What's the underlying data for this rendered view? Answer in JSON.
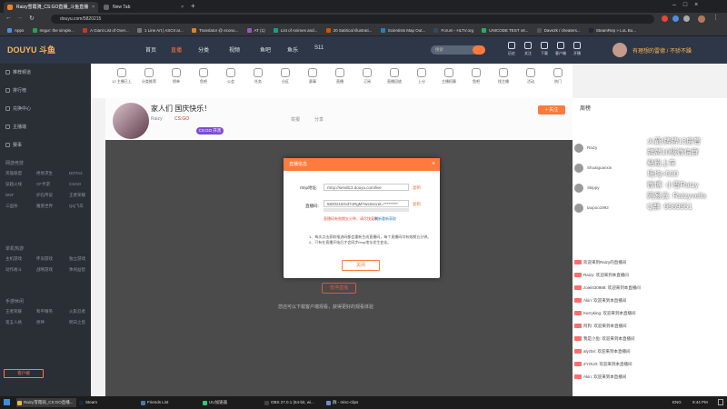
{
  "browser": {
    "tabs": [
      {
        "label": "Raizy雪霞骑_CS:GO直播_斗鱼直播",
        "active": true,
        "color": "#f48024"
      },
      {
        "label": "New Tab",
        "active": false,
        "color": "#666666"
      }
    ],
    "url": "douyu.com/5820215",
    "bookmarks": [
      "Apps",
      "Imgur: the simple...",
      "A Giant List of Over...",
      "1 Line Art | ASCII ar...",
      "Translator @ econo...",
      "AT (1)",
      "List of Animes and...",
      "20 Satirical Illustrati...",
      "Scientists Map Out...",
      "Forum - HLTV.org",
      "UNICODE TEST v8...",
      "Dave2k / cheaters...",
      "SteamRep » LoL Bo..."
    ]
  },
  "header": {
    "logo": "DOUYU 斗鱼",
    "nav": [
      "首页",
      "直播",
      "分类",
      "视频",
      "鱼吧",
      "鱼乐",
      "S11"
    ],
    "search_placeholder": "搜索",
    "icons": [
      "历史",
      "关注",
      "下载",
      "客户端",
      "开播"
    ],
    "user_label": "有理想的雷德 / 不骄不躁"
  },
  "sidebar": {
    "items": [
      "推荐频道",
      "排行榜",
      "兑换中心",
      "主播端",
      "赛事",
      "手机游戏"
    ],
    "sections": [
      {
        "title": "网游竞技",
        "subs": [
          "英雄联盟",
          "绝地求生",
          "DOTA2",
          "穿越火线",
          "CF手游",
          "CSGO",
          "DNF",
          "炉石传说",
          "王者荣耀",
          "三国杀",
          "魔兽世界",
          "QQ飞车"
        ]
      },
      {
        "title": "单机热游",
        "subs": [
          "主机游戏",
          "怀旧游戏",
          "独立游戏",
          "动作格斗",
          "战略游戏",
          "休闲益智"
        ]
      },
      {
        "title": "手游休闲",
        "subs": [
          "王者荣耀",
          "和平精英",
          "火影忍者",
          "第五人格",
          "原神",
          "明日之后"
        ]
      }
    ],
    "footer": "客户端"
  },
  "categories": [
    "12 主播已上",
    "分类推荐",
    "榜单",
    "鱼吧",
    "公会",
    "任务",
    "分区",
    "赛事",
    "直播",
    "订阅",
    "直播回放",
    "上分",
    "主播招募",
    "鱼吧",
    "找主播",
    "活动",
    "热门"
  ],
  "room": {
    "title": "家人们 国庆快乐！",
    "streamer": "Raizy",
    "tags": [
      "CS:GO",
      "CS:GO 开黑"
    ],
    "follow_label": "+ 关注",
    "report_label": "举报",
    "share_label": "分享"
  },
  "player": {
    "hint": "您还可以下载客户端观看，获得更好的观看体验",
    "stop_label": "暂停直播"
  },
  "modal": {
    "title": "直播信息",
    "close": "×",
    "rtmp_label": "rtmp地址:",
    "rtmp_value": "rtmp://sendtc3.douyu.com/live",
    "key_label": "直播码:",
    "key_value": "5820215rnd7oRgM?wsSecret=*********",
    "copy_label": "复制",
    "warning": "直播码有效期五分钟，请尽快复制",
    "warning_link": "刷新重新获取",
    "notes": [
      "1、每次点击获取推流码都会重新生成直播码，每个直播码均有效期五分钟。",
      "2、只有在直播开始后才会同步rtmp地址发生变化。"
    ],
    "ok_label": "关闭"
  },
  "overlay": {
    "lines": [
      "火箭/牌牌13房管",
      "牌牌10级微信群",
      "粘粉上车",
      "场均>500",
      "微博: 小雪Raizy",
      "网易云: Raizyvella",
      "Q群: 9569951"
    ]
  },
  "right_panel": {
    "rank_title": "周榜",
    "users": [
      "Raizy",
      "Shuaiguanxin",
      "Skippy",
      "taopoo1992"
    ],
    "chat": [
      "欢迎来到Raizy的直播间",
      "Raizy: 欢迎来到本直播间",
      "zoiel430988: 欢迎来到本直播间",
      "Akin: 欢迎来到本直播间",
      "Kerryking: 欢迎来到本直播间",
      "阿狗: 欢迎来到本直播间",
      "我是小鱼: 欢迎来到本直播间",
      "alyzbri: 欢迎来到本直播间",
      "ZYOU0: 欢迎来到本直播间",
      "Akin: 欢迎来到本直播间"
    ]
  },
  "taskbar": {
    "items": [
      "Raizy雪霞骑_CS:GO直播...",
      "Steam",
      "Friends List",
      "UU加速器",
      "OBS 27.0.1 (64-bit, wi...",
      "群 - misc-clips"
    ],
    "time": "9:44 PM",
    "lang": "ENG"
  }
}
